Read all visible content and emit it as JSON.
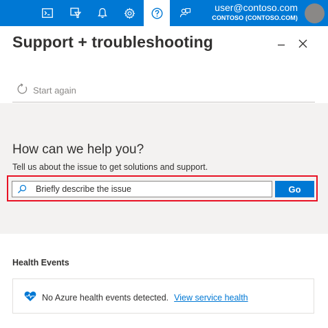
{
  "topbar": {
    "icons": [
      "cloud-shell-icon",
      "directory-filter-icon",
      "notifications-icon",
      "settings-icon",
      "help-icon",
      "feedback-icon"
    ],
    "active_icon": "help-icon",
    "account": {
      "email": "user@contoso.com",
      "tenant": "CONTOSO (CONTOSO.COM)"
    }
  },
  "blade": {
    "title": "Support + troubleshooting",
    "start_again": "Start again"
  },
  "help": {
    "title": "How can we help you?",
    "subtitle": "Tell us about the issue to get solutions and support.",
    "search_placeholder": "Briefly describe the issue",
    "go_label": "Go"
  },
  "health": {
    "title": "Health Events",
    "message": "No Azure health events detected.",
    "link": "View service health"
  },
  "colors": {
    "brand": "#0078d4",
    "highlight": "#e81123",
    "section_bg": "#f3f2f1"
  }
}
